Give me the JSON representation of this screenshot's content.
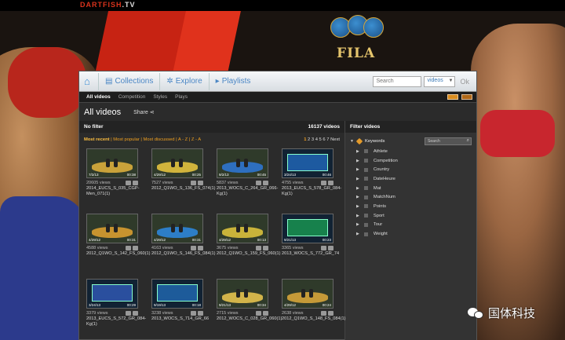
{
  "brand": {
    "name": "DARTFISH",
    "suffix": ".TV"
  },
  "logo": {
    "text": "FILA"
  },
  "nav": {
    "items": [
      {
        "label": "Collections",
        "icon": "stack-icon"
      },
      {
        "label": "Explore",
        "icon": "explore-icon"
      },
      {
        "label": "Playlists",
        "icon": "playlist-icon"
      }
    ],
    "search_placeholder": "Search",
    "search_scope": "videos",
    "ok_label": "Ok"
  },
  "subtabs": [
    "All videos",
    "Competition",
    "Styles",
    "Plays"
  ],
  "header": {
    "title": "All videos",
    "share_label": "Share"
  },
  "filterbar": {
    "label": "No filter",
    "count": "16137 videos"
  },
  "sortbar": {
    "most_recent": "Most recent",
    "most_popular": "Most popular",
    "most_discussed": "Most discussed",
    "az": "A - Z",
    "za": "Z - A",
    "current_page": "1",
    "pages": "2 3 4 5 6 7",
    "next": "Next"
  },
  "videos": [
    {
      "views": "20605 views",
      "name": "2014_EUCS_S_035_CGP-Men_071(1)",
      "date": "7/2/13",
      "duration": "00:38",
      "mat": "#c9a23a"
    },
    {
      "views": "7527 views",
      "name": "2012_Q1WO_S_136_FS_074(1)",
      "date": "4/29/12",
      "duration": "00:25",
      "mat": "#d1b43c"
    },
    {
      "views": "5837 views",
      "name": "2013_WOCS_C_264_GR_066-Kg(1)",
      "date": "9/2/13",
      "duration": "00:45",
      "mat": "#2e6fbf"
    },
    {
      "views": "4755 views",
      "name": "2013_EUCS_S_578_GR_084-Kg(1)",
      "date": "3/24/13",
      "duration": "00:46",
      "mat": "#1d5aa0"
    },
    {
      "views": "4588 views",
      "name": "2012_Q1WO_S_142_FS_060(1)",
      "date": "4/29/12",
      "duration": "00:31",
      "mat": "#c7932f"
    },
    {
      "views": "4163 views",
      "name": "2012_Q1WO_S_146_FS_084(1)",
      "date": "4/29/12",
      "duration": "00:31",
      "mat": "#2d7ec7"
    },
    {
      "views": "3675 views",
      "name": "2012_Q1WO_S_159_FS_060(1)",
      "date": "4/29/12",
      "duration": "00:13",
      "mat": "#c9b33a"
    },
    {
      "views": "3365 views",
      "name": "2013_WOCS_S_772_GR_74",
      "date": "9/21/13",
      "duration": "00:23",
      "mat": "#17814c"
    },
    {
      "views": "3379 views",
      "name": "2013_EUCS_S_572_GR_084-Kg(1)",
      "date": "3/24/13",
      "duration": "00:29",
      "mat": "#2a4f9e"
    },
    {
      "views": "3238 views",
      "name": "2013_WOCS_S_714_GR_66",
      "date": "9/19/13",
      "duration": "00:18",
      "mat": "#1d5b9a"
    },
    {
      "views": "2715 views",
      "name": "2012_WOCS_C_028_GR_060(1)",
      "date": "9/21/13",
      "duration": "00:34",
      "mat": "#d2b44a"
    },
    {
      "views": "2638 views",
      "name": "2012_Q1WO_S_148_FS_084(1)",
      "date": "4/29/12",
      "duration": "00:24",
      "mat": "#c59a38"
    }
  ],
  "filters": {
    "title": "Filter videos",
    "keywords_label": "Keywords",
    "search_placeholder": "Search",
    "items": [
      "Athlete",
      "Competition",
      "Country",
      "DateHeure",
      "Mat",
      "MatchNum",
      "Points",
      "Sport",
      "Tour",
      "Weight"
    ]
  },
  "watermark": {
    "text": "国体科技"
  }
}
